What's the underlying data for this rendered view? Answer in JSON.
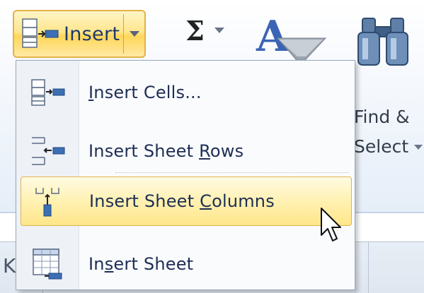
{
  "ribbon": {
    "insert_label": "Insert",
    "sum_glyph": "Σ",
    "find_label_line1": "Find &",
    "find_label_line2": "Select"
  },
  "menu": {
    "items": [
      {
        "label": "Insert Cells...",
        "underline": "I",
        "icon": "insert-cells-icon",
        "hovered": false
      },
      {
        "label": "Insert Sheet Rows",
        "underline": "R",
        "icon": "insert-rows-icon",
        "hovered": false
      },
      {
        "label": "Insert Sheet Columns",
        "underline": "C",
        "icon": "insert-columns-icon",
        "hovered": true
      },
      {
        "label": "Insert Sheet",
        "underline": "s",
        "icon": "insert-sheet-icon",
        "hovered": false
      }
    ]
  },
  "sheet": {
    "column_letter_partial": "K"
  },
  "colors": {
    "hover_fill": "#ffe68a",
    "hover_border": "#e0b34c",
    "menu_text": "#1e2e55"
  }
}
